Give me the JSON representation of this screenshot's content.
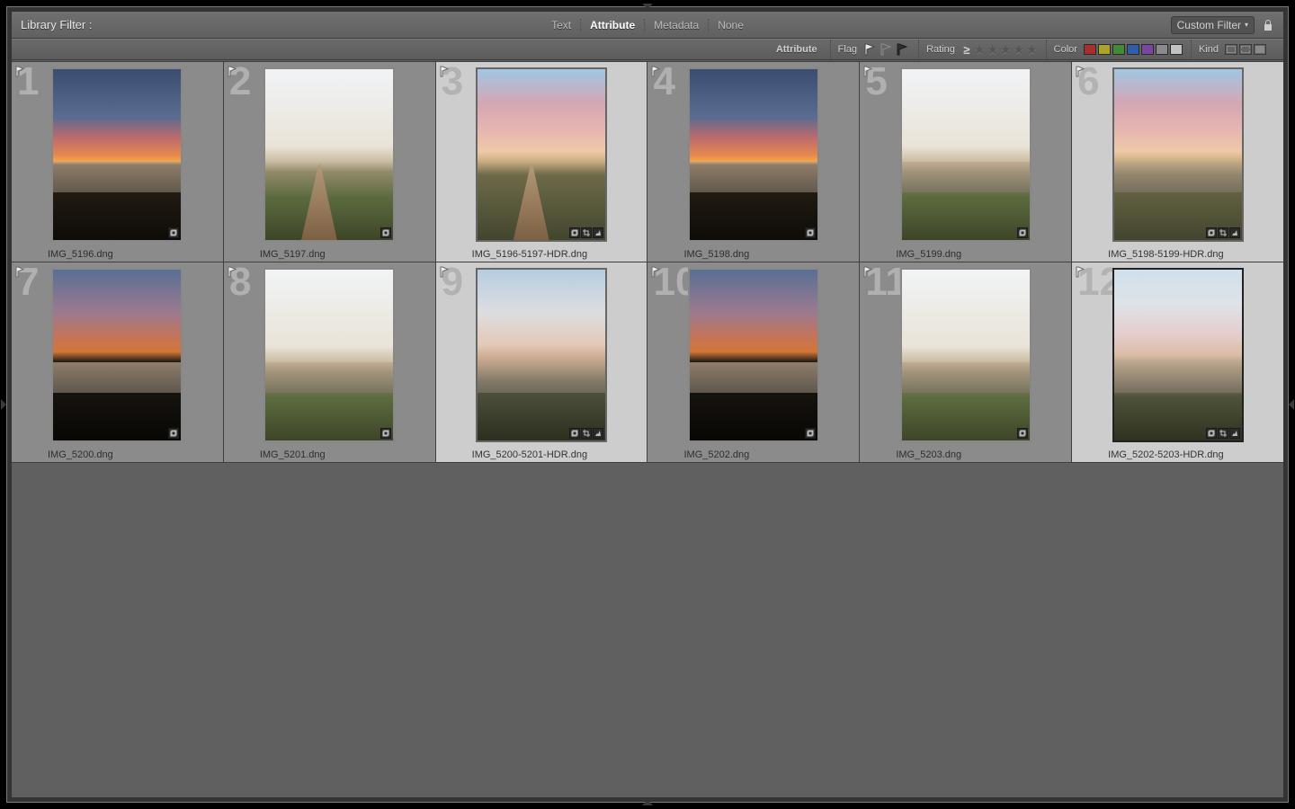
{
  "filter_bar": {
    "title": "Library Filter :",
    "tabs": [
      "Text",
      "Attribute",
      "Metadata",
      "None"
    ],
    "active_tab": "Attribute",
    "custom_filter_label": "Custom Filter"
  },
  "attribute_bar": {
    "title": "Attribute",
    "flag_label": "Flag",
    "rating_label": "Rating",
    "rating_op": "≥",
    "color_label": "Color",
    "kind_label": "Kind",
    "colors": [
      "#a62e2f",
      "#aba32c",
      "#428a38",
      "#2e5fa6",
      "#7946a0",
      "#8a8a8a",
      "#c3c3c3"
    ]
  },
  "thumbnails": [
    {
      "index": 1,
      "filename": "IMG_5196.dng",
      "variant": "dark water",
      "badges": [
        "stack"
      ],
      "selected": false,
      "active": false
    },
    {
      "index": 2,
      "filename": "IMG_5197.dng",
      "variant": "light road",
      "badges": [
        "stack"
      ],
      "selected": false,
      "active": false
    },
    {
      "index": 3,
      "filename": "IMG_5196-5197-HDR.dng",
      "variant": "mid road",
      "badges": [
        "stack",
        "crop",
        "hdr"
      ],
      "selected": true,
      "active": false
    },
    {
      "index": 4,
      "filename": "IMG_5198.dng",
      "variant": "dark water",
      "badges": [
        "stack"
      ],
      "selected": false,
      "active": false
    },
    {
      "index": 5,
      "filename": "IMG_5199.dng",
      "variant": "light water",
      "badges": [
        "stack"
      ],
      "selected": false,
      "active": false
    },
    {
      "index": 6,
      "filename": "IMG_5198-5199-HDR.dng",
      "variant": "mid water",
      "badges": [
        "stack",
        "crop",
        "hdr"
      ],
      "selected": true,
      "active": false
    },
    {
      "index": 7,
      "filename": "IMG_5200.dng",
      "variant": "dusk water",
      "badges": [
        "stack"
      ],
      "selected": false,
      "active": false
    },
    {
      "index": 8,
      "filename": "IMG_5201.dng",
      "variant": "light water",
      "badges": [
        "stack"
      ],
      "selected": false,
      "active": false
    },
    {
      "index": 9,
      "filename": "IMG_5200-5201-HDR.dng",
      "variant": "fade water",
      "badges": [
        "stack",
        "crop",
        "hdr"
      ],
      "selected": true,
      "active": false
    },
    {
      "index": 10,
      "filename": "IMG_5202.dng",
      "variant": "dusk water",
      "badges": [
        "stack"
      ],
      "selected": false,
      "active": false
    },
    {
      "index": 11,
      "filename": "IMG_5203.dng",
      "variant": "light water",
      "badges": [
        "stack"
      ],
      "selected": false,
      "active": false
    },
    {
      "index": 12,
      "filename": "IMG_5202-5203-HDR.dng",
      "variant": "soft water",
      "badges": [
        "stack",
        "crop",
        "hdr"
      ],
      "selected": true,
      "active": true
    }
  ]
}
